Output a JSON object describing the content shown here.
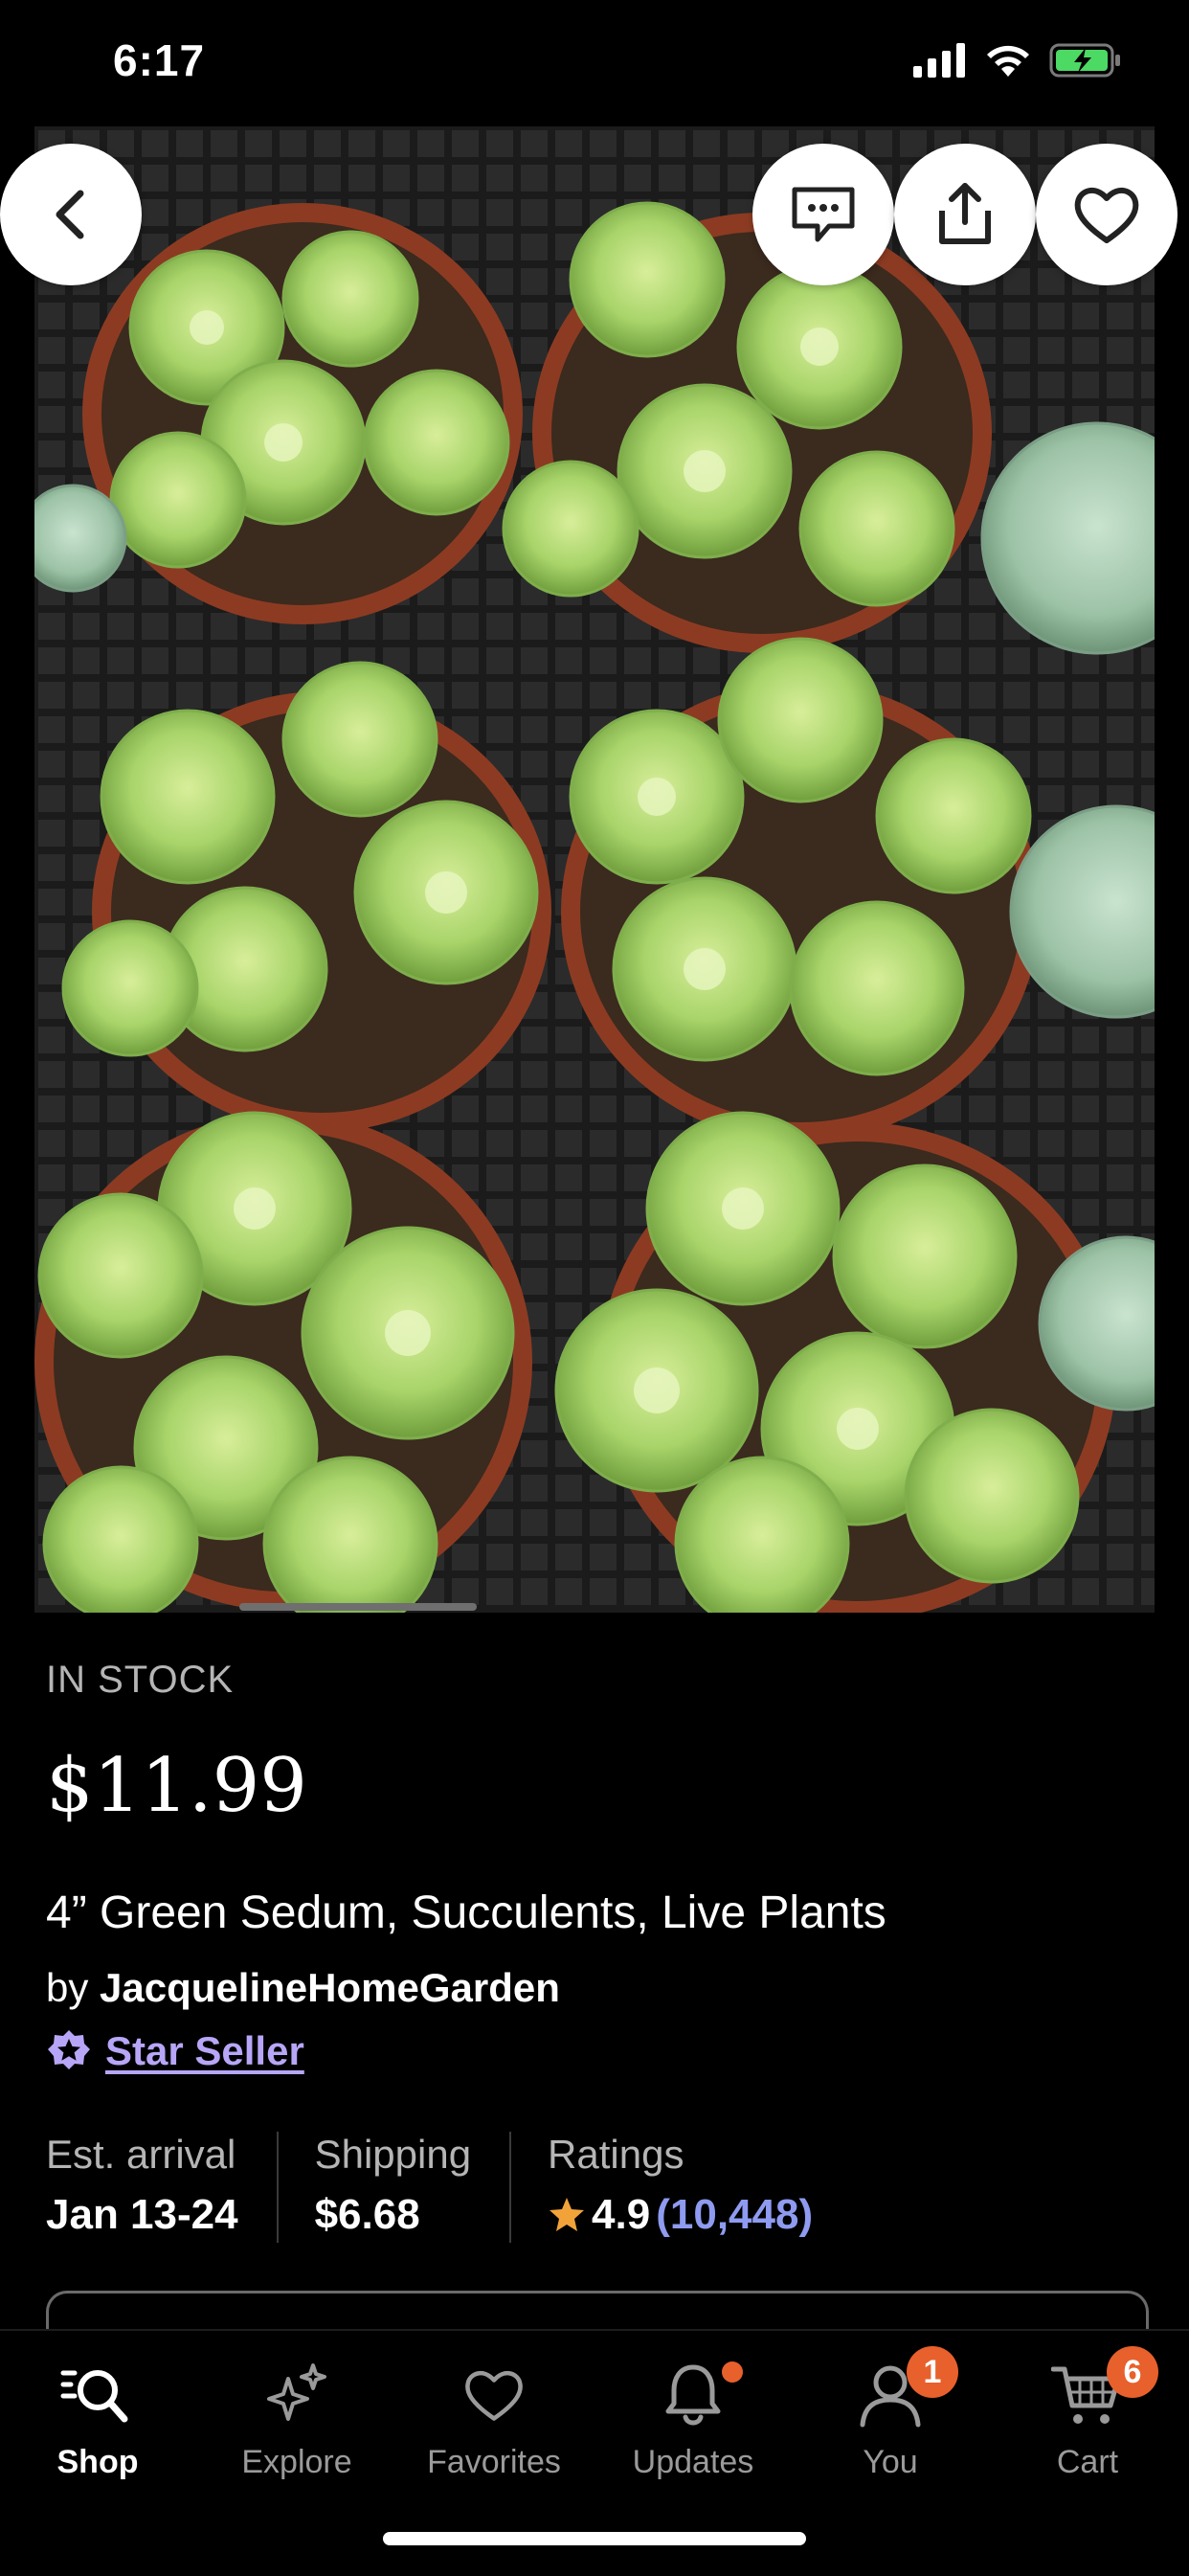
{
  "status_bar": {
    "time": "6:17"
  },
  "listing": {
    "stock_status": "IN STOCK",
    "price": "$11.99",
    "title": "4” Green Sedum, Succulents, Live Plants",
    "seller_prefix": "by",
    "seller_name": "JacquelineHomeGarden",
    "star_seller": "Star Seller"
  },
  "stats": {
    "arrival_label": "Est. arrival",
    "arrival_value": "Jan 13-24",
    "shipping_label": "Shipping",
    "shipping_value": "$6.68",
    "ratings_label": "Ratings",
    "rating_value": "4.9",
    "rating_count": "(10,448)"
  },
  "tabs": [
    {
      "label": "Shop",
      "icon": "shop-search-icon",
      "active": true
    },
    {
      "label": "Explore",
      "icon": "sparkle-icon"
    },
    {
      "label": "Favorites",
      "icon": "heart-icon"
    },
    {
      "label": "Updates",
      "icon": "bell-icon"
    },
    {
      "label": "You",
      "icon": "person-icon",
      "badge": "1"
    },
    {
      "label": "Cart",
      "icon": "cart-icon",
      "badge": "6"
    }
  ],
  "colors": {
    "accent_purple": "#b7a6f7",
    "badge_orange": "#e8602c",
    "rating_link": "#8e9bf0",
    "star": "#f1a33a"
  }
}
